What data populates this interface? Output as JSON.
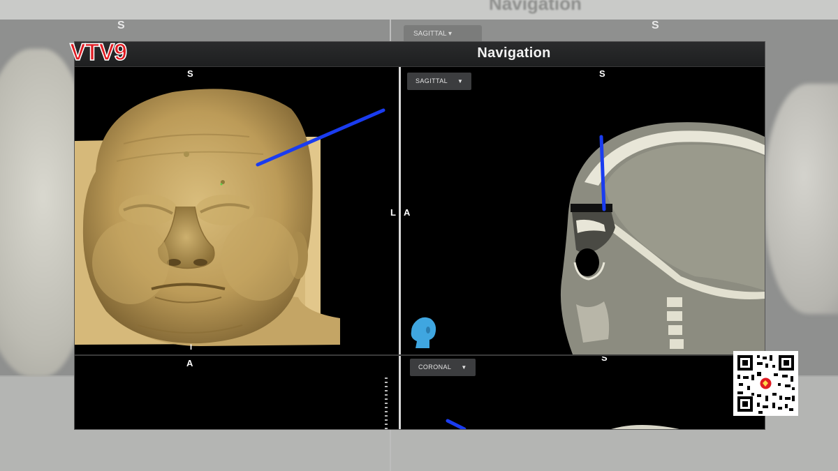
{
  "background": {
    "ghost_title": "Navigation",
    "ghost_superior": "S",
    "ghost_dropdown": "SAGITTAL"
  },
  "window": {
    "title": "Navigation"
  },
  "views": {
    "three_d": {
      "orientation_top": "S",
      "orientation_right": "L",
      "orientation_bottom": "I",
      "orientation_bottom2": "A"
    },
    "sagittal": {
      "view_selector": "SAGITTAL",
      "orientation_top": "S",
      "orientation_left": "A"
    },
    "coronal": {
      "view_selector": "CORONAL",
      "orientation_top": "S"
    }
  },
  "colors": {
    "probe": "#1a3cf0",
    "skin_render": "#c6a866",
    "ct_bone": "#e8e6d8",
    "ct_tissue": "#8c8c80",
    "orientation_widget": "#3fa6e0",
    "logo_red": "#e01b22",
    "logo_blue": "#1a5cc4"
  },
  "icons": {
    "dropdown": "caret-down-icon",
    "orientation_widget": "head-orientation-icon",
    "channel_logo": "vtv9-logo",
    "qr": "qr-code-icon"
  },
  "overlay": {
    "channel_logo_text": "VTV9"
  }
}
